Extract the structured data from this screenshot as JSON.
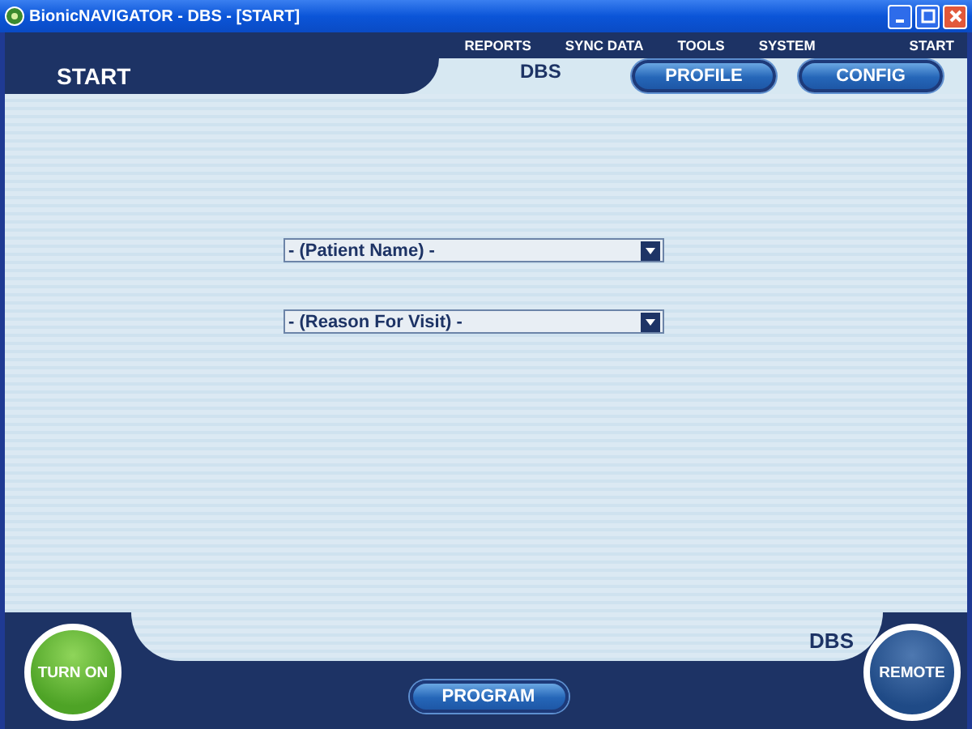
{
  "window": {
    "title": "BionicNAVIGATOR - DBS - [START]"
  },
  "menu": [
    "REPORTS",
    "SYNC DATA",
    "TOOLS",
    "SYSTEM",
    "START"
  ],
  "header": {
    "section": "START",
    "mode": "DBS",
    "buttons": [
      "PROFILE",
      "CONFIG"
    ]
  },
  "dropdowns": [
    {
      "value": "- (Patient Name) -"
    },
    {
      "value": "- (Reason For Visit) -"
    }
  ],
  "footer": {
    "mode": "DBS",
    "turn_on": "TURN ON",
    "program": "PROGRAM",
    "remote": "REMOTE"
  }
}
